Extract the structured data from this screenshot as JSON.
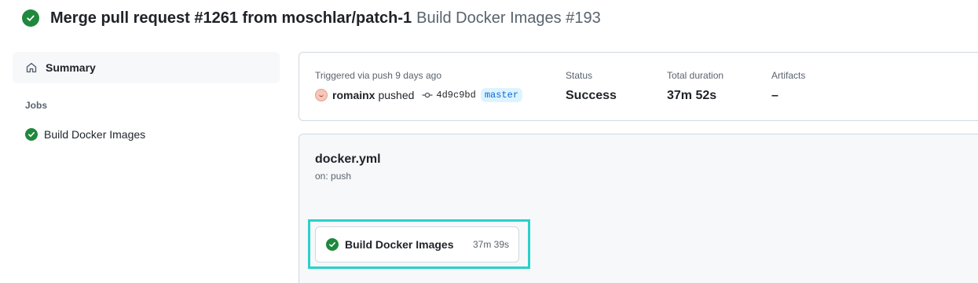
{
  "header": {
    "title": "Merge pull request #1261 from moschlar/patch-1",
    "subtitle": "Build Docker Images #193",
    "status_icon": "check-circle-icon"
  },
  "sidebar": {
    "summary_label": "Summary",
    "summary_icon": "home-icon",
    "jobs_heading": "Jobs",
    "jobs": [
      {
        "label": "Build Docker Images",
        "status": "success"
      }
    ]
  },
  "run_info": {
    "trigger_label": "Triggered via push 9 days ago",
    "actor": "romainx",
    "action": "pushed",
    "commit_sha": "4d9c9bd",
    "branch": "master",
    "status_label": "Status",
    "status_value": "Success",
    "duration_label": "Total duration",
    "duration_value": "37m 52s",
    "artifacts_label": "Artifacts",
    "artifacts_value": "–"
  },
  "workflow": {
    "file": "docker.yml",
    "trigger": "on: push",
    "jobs": [
      {
        "label": "Build Docker Images",
        "duration": "37m 39s",
        "status": "success"
      }
    ]
  },
  "colors": {
    "success": "#1f883d",
    "highlight": "#2ad1c9",
    "link": "#0969da",
    "muted": "#59636e"
  }
}
